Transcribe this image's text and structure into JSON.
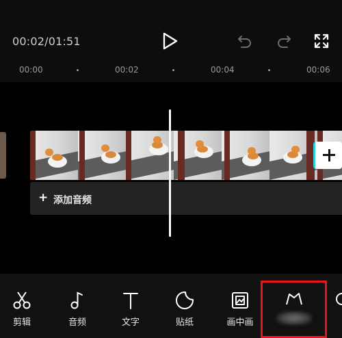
{
  "header": {
    "timecode": "00:02/01:51",
    "play_icon": "play-icon",
    "undo_icon": "undo-icon",
    "redo_icon": "redo-icon",
    "fullscreen_icon": "fullscreen-icon"
  },
  "ruler": {
    "ticks": [
      "00:00",
      "00:02",
      "00:04",
      "00:06"
    ]
  },
  "timeline": {
    "add_clip_icon": "plus-icon",
    "audio": {
      "plus": "+",
      "label": "添加音频"
    }
  },
  "toolbar": {
    "items": [
      {
        "label": "剪辑",
        "icon": "scissors-icon"
      },
      {
        "label": "音频",
        "icon": "music-note-icon"
      },
      {
        "label": "文字",
        "icon": "text-icon"
      },
      {
        "label": "贴纸",
        "icon": "sticker-icon"
      },
      {
        "label": "画中画",
        "icon": "picture-in-picture-icon"
      }
    ]
  },
  "colors": {
    "background": "#000000",
    "panel": "#0d0d0d",
    "toolbar": "#111111",
    "audio_track": "#232323",
    "highlight": "#e8151b",
    "accent_cyan": "#2dd4e0"
  }
}
